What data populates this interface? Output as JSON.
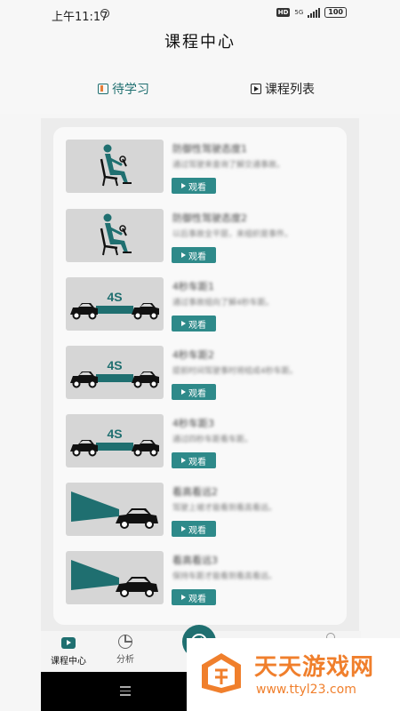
{
  "status_bar": {
    "time": "上午11:17",
    "hd": "HD",
    "network": "5G",
    "battery": "100"
  },
  "header": {
    "title": "课程中心"
  },
  "tabs": [
    {
      "label": "待学习",
      "icon": "book-icon",
      "active": true
    },
    {
      "label": "课程列表",
      "icon": "play-box-icon",
      "active": false
    }
  ],
  "colors": {
    "accent": "#1f6f70",
    "button": "#2e8a8a",
    "watermark": "#f07f2c"
  },
  "lessons": [
    {
      "title": "防御性驾驶态度1",
      "desc": "通过驾驶来查询了解交通事故。",
      "button": "观看",
      "thumb": "driver-seat"
    },
    {
      "title": "防御性驾驶态度2",
      "desc": "以后事故全平层，来组织是事件。",
      "button": "观看",
      "thumb": "driver-seat"
    },
    {
      "title": "4秒车距1",
      "desc": "通过事故组向了解4秒车距。",
      "button": "观看",
      "thumb": "four-second"
    },
    {
      "title": "4秒车距2",
      "desc": "提前时间驾驶事时将结成4秒车距。",
      "button": "观看",
      "thumb": "four-second"
    },
    {
      "title": "4秒车距3",
      "desc": "通过四秒车距看车距。",
      "button": "观看",
      "thumb": "four-second"
    },
    {
      "title": "看高看远2",
      "desc": "驾驶上坡才能看到看高看远。",
      "button": "观看",
      "thumb": "headlight"
    },
    {
      "title": "看高看远3",
      "desc": "保持车距才能看到看高看远。",
      "button": "观看",
      "thumb": "headlight"
    }
  ],
  "thumb_label": "4S",
  "bottom_nav": [
    {
      "label": "课程中心",
      "icon": "video-icon"
    },
    {
      "label": "分析",
      "icon": "pie-chart-icon"
    }
  ],
  "watermark": {
    "name": "天天游戏网",
    "url": "www.ttyl23.com"
  }
}
